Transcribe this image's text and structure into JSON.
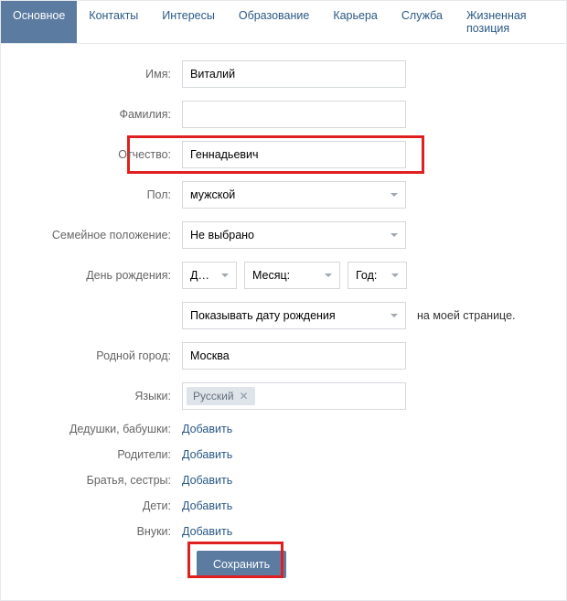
{
  "tabs": [
    "Основное",
    "Контакты",
    "Интересы",
    "Образование",
    "Карьера",
    "Служба",
    "Жизненная позиция"
  ],
  "active_tab_index": 0,
  "labels": {
    "name": "Имя:",
    "surname": "Фамилия:",
    "patronymic": "Отчество:",
    "sex": "Пол:",
    "marital": "Семейное положение:",
    "birthday": "День рождения:",
    "birth_vis_suffix": "на моей странице.",
    "hometown": "Родной город:",
    "languages": "Языки:",
    "grandparents": "Дедушки, бабушки:",
    "parents": "Родители:",
    "siblings": "Братья, сестры:",
    "children": "Дети:",
    "grandchildren": "Внуки:"
  },
  "values": {
    "name": "Виталий",
    "surname": "",
    "patronymic": "Геннадьевич",
    "sex": "мужской",
    "marital": "Не выбрано",
    "birth_day": "Д…",
    "birth_month": "Месяц:",
    "birth_year": "Год:",
    "birth_vis": "Показывать дату рождения",
    "hometown": "Москва",
    "language_tag": "Русский"
  },
  "link_add": "Добавить",
  "save": "Сохранить"
}
